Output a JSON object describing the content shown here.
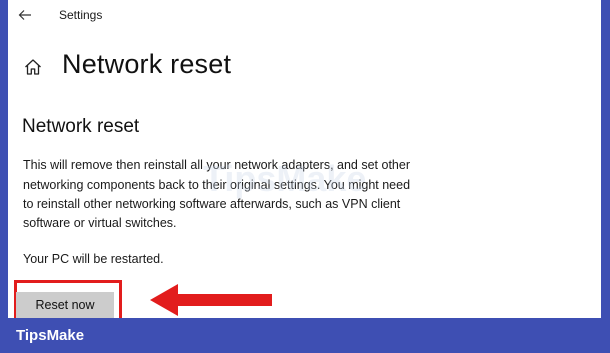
{
  "window": {
    "title": "Settings",
    "back_icon": "arrow-left-icon"
  },
  "header": {
    "home_icon": "home-icon",
    "title": "Network reset"
  },
  "section": {
    "title": "Network reset",
    "description_lines": [
      "This will remove then reinstall all your network adapters, and set other",
      "networking components back to their original settings. You might need",
      "to reinstall other networking software afterwards, such as VPN client",
      "software or virtual switches."
    ],
    "restart_note": "Your PC will be restarted.",
    "reset_button_label": "Reset now"
  },
  "annotation": {
    "highlight_color": "#e21d1d",
    "arrow_color": "#e21d1d"
  },
  "watermark": {
    "text": "TipsMake"
  },
  "brand": {
    "name": "TipsMake",
    "bar_color": "#3e4fb3"
  }
}
